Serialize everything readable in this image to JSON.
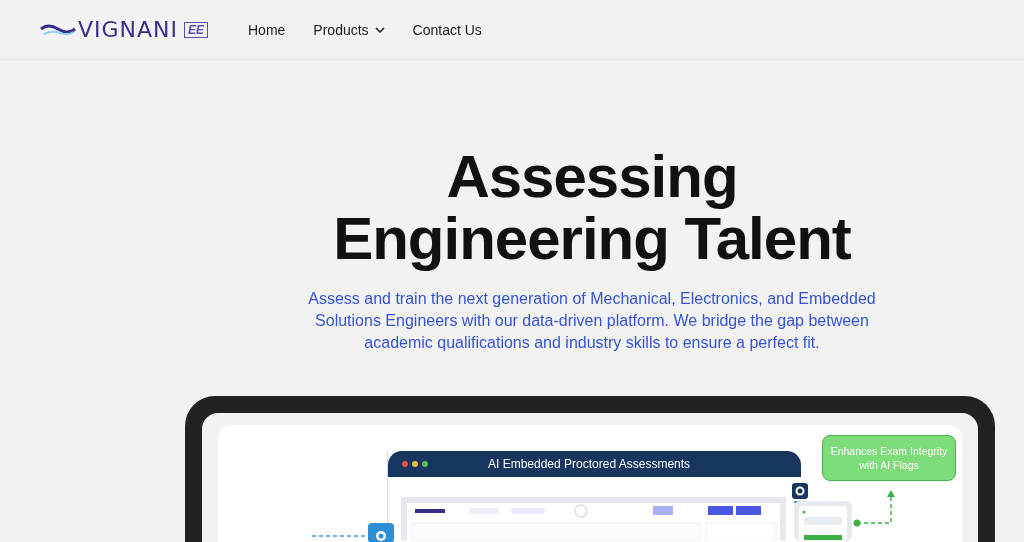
{
  "header": {
    "logo": {
      "text": "VIGNANI",
      "badge": "EE"
    },
    "nav": [
      {
        "label": "Home",
        "dropdown": false
      },
      {
        "label": "Products",
        "dropdown": true
      },
      {
        "label": "Contact Us",
        "dropdown": false
      }
    ]
  },
  "hero": {
    "title_lines": [
      "Assessing",
      "Engineering Talent"
    ],
    "subtitle": "Assess and train the next generation of Mechanical, Electronics, and Embedded Solutions Engineers with our data-driven platform. We bridge the gap between academic qualifications and industry skills to ensure a perfect fit."
  },
  "device": {
    "window_title": "AI Embedded Proctored Assessments",
    "callout": "Enhances Exam Integrity with AI Flags"
  }
}
